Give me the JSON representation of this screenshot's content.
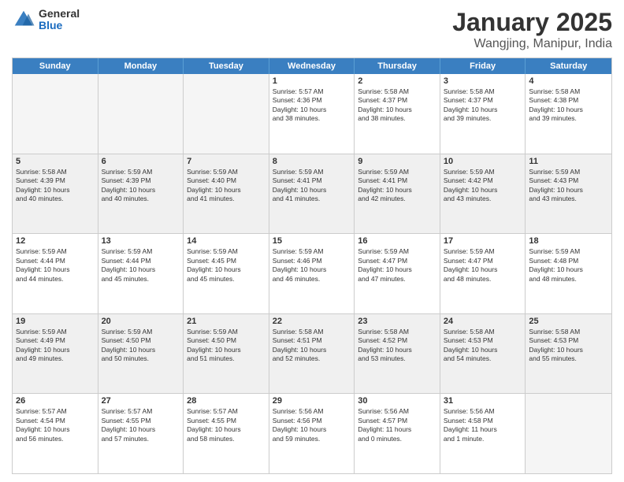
{
  "header": {
    "logo_general": "General",
    "logo_blue": "Blue",
    "title": "January 2025",
    "subtitle": "Wangjing, Manipur, India"
  },
  "weekdays": [
    "Sunday",
    "Monday",
    "Tuesday",
    "Wednesday",
    "Thursday",
    "Friday",
    "Saturday"
  ],
  "rows": [
    {
      "shade": false,
      "cells": [
        {
          "num": "",
          "info": ""
        },
        {
          "num": "",
          "info": ""
        },
        {
          "num": "",
          "info": ""
        },
        {
          "num": "1",
          "info": "Sunrise: 5:57 AM\nSunset: 4:36 PM\nDaylight: 10 hours\nand 38 minutes."
        },
        {
          "num": "2",
          "info": "Sunrise: 5:58 AM\nSunset: 4:37 PM\nDaylight: 10 hours\nand 38 minutes."
        },
        {
          "num": "3",
          "info": "Sunrise: 5:58 AM\nSunset: 4:37 PM\nDaylight: 10 hours\nand 39 minutes."
        },
        {
          "num": "4",
          "info": "Sunrise: 5:58 AM\nSunset: 4:38 PM\nDaylight: 10 hours\nand 39 minutes."
        }
      ]
    },
    {
      "shade": true,
      "cells": [
        {
          "num": "5",
          "info": "Sunrise: 5:58 AM\nSunset: 4:39 PM\nDaylight: 10 hours\nand 40 minutes."
        },
        {
          "num": "6",
          "info": "Sunrise: 5:59 AM\nSunset: 4:39 PM\nDaylight: 10 hours\nand 40 minutes."
        },
        {
          "num": "7",
          "info": "Sunrise: 5:59 AM\nSunset: 4:40 PM\nDaylight: 10 hours\nand 41 minutes."
        },
        {
          "num": "8",
          "info": "Sunrise: 5:59 AM\nSunset: 4:41 PM\nDaylight: 10 hours\nand 41 minutes."
        },
        {
          "num": "9",
          "info": "Sunrise: 5:59 AM\nSunset: 4:41 PM\nDaylight: 10 hours\nand 42 minutes."
        },
        {
          "num": "10",
          "info": "Sunrise: 5:59 AM\nSunset: 4:42 PM\nDaylight: 10 hours\nand 43 minutes."
        },
        {
          "num": "11",
          "info": "Sunrise: 5:59 AM\nSunset: 4:43 PM\nDaylight: 10 hours\nand 43 minutes."
        }
      ]
    },
    {
      "shade": false,
      "cells": [
        {
          "num": "12",
          "info": "Sunrise: 5:59 AM\nSunset: 4:44 PM\nDaylight: 10 hours\nand 44 minutes."
        },
        {
          "num": "13",
          "info": "Sunrise: 5:59 AM\nSunset: 4:44 PM\nDaylight: 10 hours\nand 45 minutes."
        },
        {
          "num": "14",
          "info": "Sunrise: 5:59 AM\nSunset: 4:45 PM\nDaylight: 10 hours\nand 45 minutes."
        },
        {
          "num": "15",
          "info": "Sunrise: 5:59 AM\nSunset: 4:46 PM\nDaylight: 10 hours\nand 46 minutes."
        },
        {
          "num": "16",
          "info": "Sunrise: 5:59 AM\nSunset: 4:47 PM\nDaylight: 10 hours\nand 47 minutes."
        },
        {
          "num": "17",
          "info": "Sunrise: 5:59 AM\nSunset: 4:47 PM\nDaylight: 10 hours\nand 48 minutes."
        },
        {
          "num": "18",
          "info": "Sunrise: 5:59 AM\nSunset: 4:48 PM\nDaylight: 10 hours\nand 48 minutes."
        }
      ]
    },
    {
      "shade": true,
      "cells": [
        {
          "num": "19",
          "info": "Sunrise: 5:59 AM\nSunset: 4:49 PM\nDaylight: 10 hours\nand 49 minutes."
        },
        {
          "num": "20",
          "info": "Sunrise: 5:59 AM\nSunset: 4:50 PM\nDaylight: 10 hours\nand 50 minutes."
        },
        {
          "num": "21",
          "info": "Sunrise: 5:59 AM\nSunset: 4:50 PM\nDaylight: 10 hours\nand 51 minutes."
        },
        {
          "num": "22",
          "info": "Sunrise: 5:58 AM\nSunset: 4:51 PM\nDaylight: 10 hours\nand 52 minutes."
        },
        {
          "num": "23",
          "info": "Sunrise: 5:58 AM\nSunset: 4:52 PM\nDaylight: 10 hours\nand 53 minutes."
        },
        {
          "num": "24",
          "info": "Sunrise: 5:58 AM\nSunset: 4:53 PM\nDaylight: 10 hours\nand 54 minutes."
        },
        {
          "num": "25",
          "info": "Sunrise: 5:58 AM\nSunset: 4:53 PM\nDaylight: 10 hours\nand 55 minutes."
        }
      ]
    },
    {
      "shade": false,
      "cells": [
        {
          "num": "26",
          "info": "Sunrise: 5:57 AM\nSunset: 4:54 PM\nDaylight: 10 hours\nand 56 minutes."
        },
        {
          "num": "27",
          "info": "Sunrise: 5:57 AM\nSunset: 4:55 PM\nDaylight: 10 hours\nand 57 minutes."
        },
        {
          "num": "28",
          "info": "Sunrise: 5:57 AM\nSunset: 4:55 PM\nDaylight: 10 hours\nand 58 minutes."
        },
        {
          "num": "29",
          "info": "Sunrise: 5:56 AM\nSunset: 4:56 PM\nDaylight: 10 hours\nand 59 minutes."
        },
        {
          "num": "30",
          "info": "Sunrise: 5:56 AM\nSunset: 4:57 PM\nDaylight: 11 hours\nand 0 minutes."
        },
        {
          "num": "31",
          "info": "Sunrise: 5:56 AM\nSunset: 4:58 PM\nDaylight: 11 hours\nand 1 minute."
        },
        {
          "num": "",
          "info": ""
        }
      ]
    }
  ]
}
